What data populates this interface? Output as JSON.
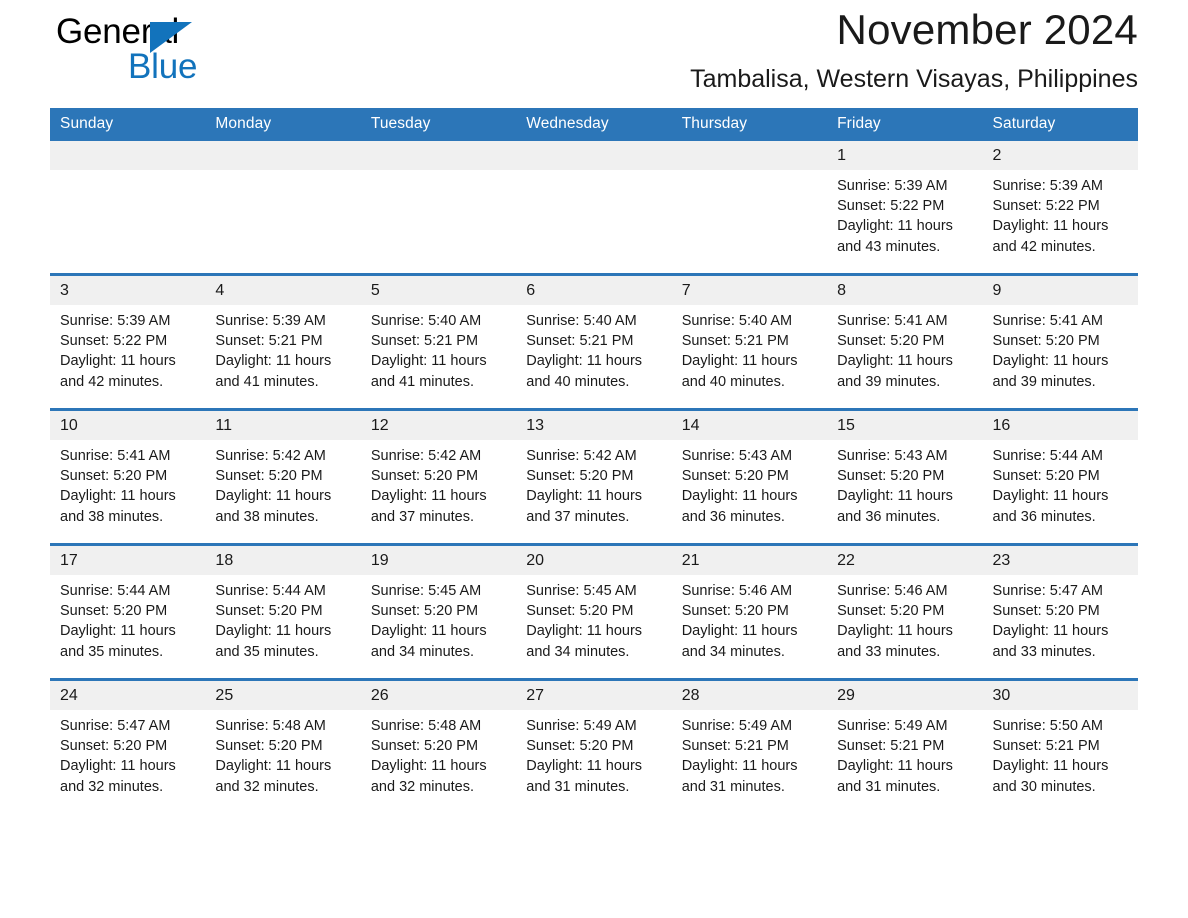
{
  "brand": {
    "word_one": "General",
    "word_two": "Blue",
    "logo_icon": "triangle-logo-icon",
    "accent_color": "#1273bc"
  },
  "header": {
    "month_title": "November 2024",
    "location_title": "Tambalisa, Western Visayas, Philippines"
  },
  "calendar": {
    "header_color": "#2c76b8",
    "daynum_band_color": "#f0f0f0",
    "weekdays": [
      "Sunday",
      "Monday",
      "Tuesday",
      "Wednesday",
      "Thursday",
      "Friday",
      "Saturday"
    ],
    "weeks": [
      [
        {
          "day": "",
          "empty": true
        },
        {
          "day": "",
          "empty": true
        },
        {
          "day": "",
          "empty": true
        },
        {
          "day": "",
          "empty": true
        },
        {
          "day": "",
          "empty": true
        },
        {
          "day": "1",
          "sunrise": "Sunrise: 5:39 AM",
          "sunset": "Sunset: 5:22 PM",
          "daylight": "Daylight: 11 hours and 43 minutes."
        },
        {
          "day": "2",
          "sunrise": "Sunrise: 5:39 AM",
          "sunset": "Sunset: 5:22 PM",
          "daylight": "Daylight: 11 hours and 42 minutes."
        }
      ],
      [
        {
          "day": "3",
          "sunrise": "Sunrise: 5:39 AM",
          "sunset": "Sunset: 5:22 PM",
          "daylight": "Daylight: 11 hours and 42 minutes."
        },
        {
          "day": "4",
          "sunrise": "Sunrise: 5:39 AM",
          "sunset": "Sunset: 5:21 PM",
          "daylight": "Daylight: 11 hours and 41 minutes."
        },
        {
          "day": "5",
          "sunrise": "Sunrise: 5:40 AM",
          "sunset": "Sunset: 5:21 PM",
          "daylight": "Daylight: 11 hours and 41 minutes."
        },
        {
          "day": "6",
          "sunrise": "Sunrise: 5:40 AM",
          "sunset": "Sunset: 5:21 PM",
          "daylight": "Daylight: 11 hours and 40 minutes."
        },
        {
          "day": "7",
          "sunrise": "Sunrise: 5:40 AM",
          "sunset": "Sunset: 5:21 PM",
          "daylight": "Daylight: 11 hours and 40 minutes."
        },
        {
          "day": "8",
          "sunrise": "Sunrise: 5:41 AM",
          "sunset": "Sunset: 5:20 PM",
          "daylight": "Daylight: 11 hours and 39 minutes."
        },
        {
          "day": "9",
          "sunrise": "Sunrise: 5:41 AM",
          "sunset": "Sunset: 5:20 PM",
          "daylight": "Daylight: 11 hours and 39 minutes."
        }
      ],
      [
        {
          "day": "10",
          "sunrise": "Sunrise: 5:41 AM",
          "sunset": "Sunset: 5:20 PM",
          "daylight": "Daylight: 11 hours and 38 minutes."
        },
        {
          "day": "11",
          "sunrise": "Sunrise: 5:42 AM",
          "sunset": "Sunset: 5:20 PM",
          "daylight": "Daylight: 11 hours and 38 minutes."
        },
        {
          "day": "12",
          "sunrise": "Sunrise: 5:42 AM",
          "sunset": "Sunset: 5:20 PM",
          "daylight": "Daylight: 11 hours and 37 minutes."
        },
        {
          "day": "13",
          "sunrise": "Sunrise: 5:42 AM",
          "sunset": "Sunset: 5:20 PM",
          "daylight": "Daylight: 11 hours and 37 minutes."
        },
        {
          "day": "14",
          "sunrise": "Sunrise: 5:43 AM",
          "sunset": "Sunset: 5:20 PM",
          "daylight": "Daylight: 11 hours and 36 minutes."
        },
        {
          "day": "15",
          "sunrise": "Sunrise: 5:43 AM",
          "sunset": "Sunset: 5:20 PM",
          "daylight": "Daylight: 11 hours and 36 minutes."
        },
        {
          "day": "16",
          "sunrise": "Sunrise: 5:44 AM",
          "sunset": "Sunset: 5:20 PM",
          "daylight": "Daylight: 11 hours and 36 minutes."
        }
      ],
      [
        {
          "day": "17",
          "sunrise": "Sunrise: 5:44 AM",
          "sunset": "Sunset: 5:20 PM",
          "daylight": "Daylight: 11 hours and 35 minutes."
        },
        {
          "day": "18",
          "sunrise": "Sunrise: 5:44 AM",
          "sunset": "Sunset: 5:20 PM",
          "daylight": "Daylight: 11 hours and 35 minutes."
        },
        {
          "day": "19",
          "sunrise": "Sunrise: 5:45 AM",
          "sunset": "Sunset: 5:20 PM",
          "daylight": "Daylight: 11 hours and 34 minutes."
        },
        {
          "day": "20",
          "sunrise": "Sunrise: 5:45 AM",
          "sunset": "Sunset: 5:20 PM",
          "daylight": "Daylight: 11 hours and 34 minutes."
        },
        {
          "day": "21",
          "sunrise": "Sunrise: 5:46 AM",
          "sunset": "Sunset: 5:20 PM",
          "daylight": "Daylight: 11 hours and 34 minutes."
        },
        {
          "day": "22",
          "sunrise": "Sunrise: 5:46 AM",
          "sunset": "Sunset: 5:20 PM",
          "daylight": "Daylight: 11 hours and 33 minutes."
        },
        {
          "day": "23",
          "sunrise": "Sunrise: 5:47 AM",
          "sunset": "Sunset: 5:20 PM",
          "daylight": "Daylight: 11 hours and 33 minutes."
        }
      ],
      [
        {
          "day": "24",
          "sunrise": "Sunrise: 5:47 AM",
          "sunset": "Sunset: 5:20 PM",
          "daylight": "Daylight: 11 hours and 32 minutes."
        },
        {
          "day": "25",
          "sunrise": "Sunrise: 5:48 AM",
          "sunset": "Sunset: 5:20 PM",
          "daylight": "Daylight: 11 hours and 32 minutes."
        },
        {
          "day": "26",
          "sunrise": "Sunrise: 5:48 AM",
          "sunset": "Sunset: 5:20 PM",
          "daylight": "Daylight: 11 hours and 32 minutes."
        },
        {
          "day": "27",
          "sunrise": "Sunrise: 5:49 AM",
          "sunset": "Sunset: 5:20 PM",
          "daylight": "Daylight: 11 hours and 31 minutes."
        },
        {
          "day": "28",
          "sunrise": "Sunrise: 5:49 AM",
          "sunset": "Sunset: 5:21 PM",
          "daylight": "Daylight: 11 hours and 31 minutes."
        },
        {
          "day": "29",
          "sunrise": "Sunrise: 5:49 AM",
          "sunset": "Sunset: 5:21 PM",
          "daylight": "Daylight: 11 hours and 31 minutes."
        },
        {
          "day": "30",
          "sunrise": "Sunrise: 5:50 AM",
          "sunset": "Sunset: 5:21 PM",
          "daylight": "Daylight: 11 hours and 30 minutes."
        }
      ]
    ]
  }
}
